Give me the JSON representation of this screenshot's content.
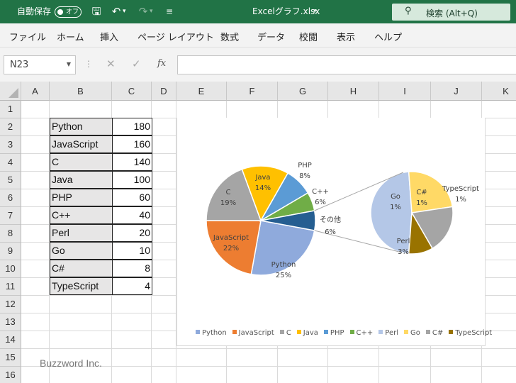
{
  "titlebar": {
    "autosave_label": "自動保存",
    "autosave_state": "オフ",
    "file_title": "Excelグラフ.xlsx",
    "search_label": "検索 (Alt+Q)"
  },
  "ribbon": {
    "tabs": [
      "ファイル",
      "ホーム",
      "挿入",
      "ページ レイアウト",
      "数式",
      "データ",
      "校閲",
      "表示",
      "ヘルプ"
    ]
  },
  "formula_bar": {
    "name_box": "N23",
    "fx": "fx",
    "formula": ""
  },
  "sheet": {
    "columns": [
      "A",
      "B",
      "C",
      "D",
      "E",
      "F",
      "G",
      "H",
      "I",
      "J",
      "K"
    ],
    "rows": [
      "1",
      "2",
      "3",
      "4",
      "5",
      "6",
      "7",
      "8",
      "9",
      "10",
      "11",
      "12",
      "13",
      "14",
      "15",
      "16"
    ],
    "table": [
      {
        "name": "Python",
        "value": "180"
      },
      {
        "name": "JavaScript",
        "value": "160"
      },
      {
        "name": "C",
        "value": "140"
      },
      {
        "name": "Java",
        "value": "100"
      },
      {
        "name": "PHP",
        "value": "60"
      },
      {
        "name": "C++",
        "value": "40"
      },
      {
        "name": "Perl",
        "value": "20"
      },
      {
        "name": "Go",
        "value": "10"
      },
      {
        "name": "C#",
        "value": "8"
      },
      {
        "name": "TypeScript",
        "value": "4"
      }
    ]
  },
  "chart_data": {
    "type": "pie",
    "subtype": "pie-of-pie",
    "categories": [
      "Python",
      "JavaScript",
      "C",
      "Java",
      "PHP",
      "C++",
      "Perl",
      "Go",
      "C#",
      "TypeScript"
    ],
    "values": [
      180,
      160,
      140,
      100,
      60,
      40,
      20,
      10,
      8,
      4
    ],
    "colors": [
      "#8faadc",
      "#ed7d31",
      "#a5a5a5",
      "#ffc000",
      "#5b9bd5",
      "#70ad47",
      "#b4c7e7",
      "#ffd966",
      "#a5a5a5",
      "#997300"
    ],
    "other_color": "#255e91",
    "other_label": "その他",
    "other_percent": "6%",
    "main_labels": [
      {
        "name": "Python",
        "percent": "25%"
      },
      {
        "name": "JavaScript",
        "percent": "22%"
      },
      {
        "name": "C",
        "percent": "19%"
      },
      {
        "name": "Java",
        "percent": "14%"
      },
      {
        "name": "PHP",
        "percent": "8%"
      },
      {
        "name": "C++",
        "percent": "6%"
      }
    ],
    "secondary_labels": [
      {
        "name": "Perl",
        "percent": "3%"
      },
      {
        "name": "Go",
        "percent": "1%"
      },
      {
        "name": "C#",
        "percent": "1%"
      },
      {
        "name": "TypeScript",
        "percent": "1%"
      }
    ],
    "legend_position": "bottom",
    "title": ""
  },
  "watermark": "Buzzword Inc."
}
